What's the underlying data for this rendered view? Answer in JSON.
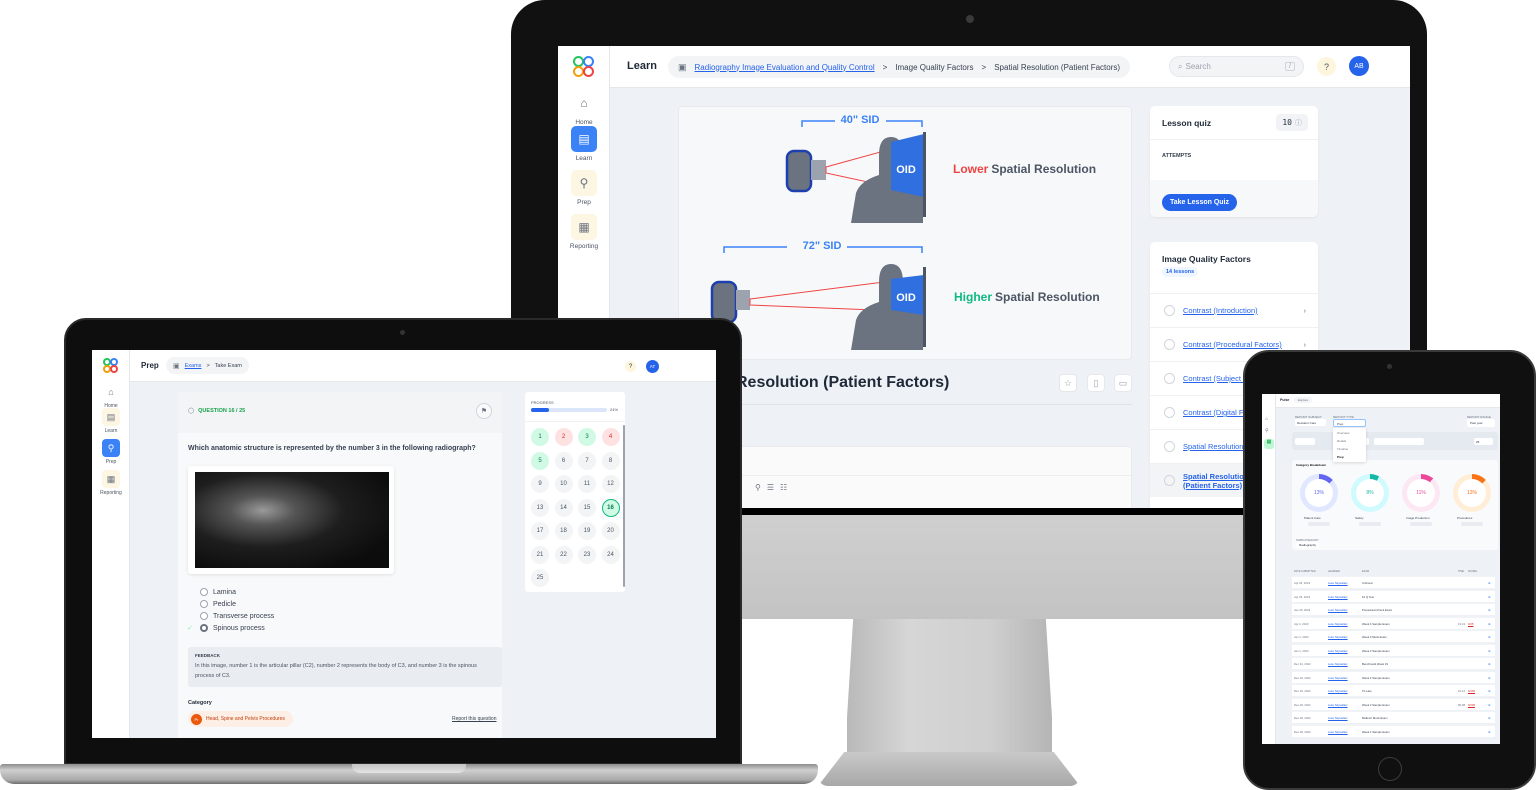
{
  "monitor": {
    "header": {
      "section_title": "Learn",
      "breadcrumb": [
        {
          "label": "Radiography Image Evaluation and Quality Control",
          "link": true
        },
        {
          "label": "Image Quality Factors",
          "link": false
        },
        {
          "label": "Spatial Resolution (Patient Factors)",
          "link": false
        }
      ],
      "breadcrumb_separator": ">",
      "search_placeholder": "Search",
      "search_shortcut": "/",
      "help_icon": "?",
      "avatar_initials": "AB"
    },
    "sidebar": {
      "items": [
        {
          "label": "Home",
          "icon": "home-icon",
          "active": false
        },
        {
          "label": "Learn",
          "icon": "book-icon",
          "active": true
        },
        {
          "label": "Prep",
          "icon": "compass-icon",
          "active": false
        },
        {
          "label": "Reporting",
          "icon": "chart-icon",
          "active": false
        }
      ]
    },
    "diagram": {
      "top": {
        "sid_label": "40\" SID",
        "oid_label": "OID",
        "result_prefix": "Lower",
        "result_suffix": "Spatial Resolution",
        "prefix_color": "#ef4444"
      },
      "bottom": {
        "sid_label": "72\" SID",
        "oid_label": "OID",
        "result_prefix": "Higher",
        "result_suffix": "Spatial Resolution",
        "prefix_color": "#10b981"
      }
    },
    "lesson_title_visible": "Resolution (Patient Factors)",
    "lesson_quiz": {
      "title": "Lesson quiz",
      "question_count": "10",
      "attempts_label": "ATTEMPTS",
      "button_label": "Take Lesson Quiz"
    },
    "lesson_list": {
      "title": "Image Quality Factors",
      "badge": "14 lessons",
      "items": [
        {
          "label": "Contrast (Introduction)",
          "active": false
        },
        {
          "label": "Contrast (Procedural Factors)",
          "active": false
        },
        {
          "label": "Contrast (Subject Factors)",
          "active": false
        },
        {
          "label": "Contrast (Digital Factors)",
          "active": false
        },
        {
          "label": "Spatial Resolution (Procedural Factors)",
          "active": false
        },
        {
          "label": "Spatial Resolution (Patient Factors)",
          "active": true
        }
      ]
    }
  },
  "laptop": {
    "header": {
      "section_title": "Prep",
      "breadcrumb": [
        {
          "label": "Exams",
          "link": true
        },
        {
          "label": "Take Exam",
          "link": false
        }
      ],
      "breadcrumb_separator": ">",
      "avatar_initials": "AT"
    },
    "sidebar": {
      "items": [
        {
          "label": "Home",
          "active": false
        },
        {
          "label": "Learn",
          "active": false
        },
        {
          "label": "Prep",
          "active": true
        },
        {
          "label": "Reporting",
          "active": false
        }
      ]
    },
    "question": {
      "counter": "QUESTION 16 / 25",
      "text": "Which anatomic structure is represented by the number 3 in the following radiograph?",
      "options": [
        "Lamina",
        "Pedicle",
        "Transverse process",
        "Spinous process"
      ],
      "selected_option": "Spinous process",
      "feedback_label": "FEEDBACK",
      "feedback_text": "In this image, number 1 is the articular pillar (C2), number 2 represents the body of C3, and number 3 is the spinous process of C3.",
      "category_label": "Category",
      "category_badge_initials": "Pr",
      "category_name": "Head, Spine and Pelvis Procedures",
      "report_link": "Report this question"
    },
    "progress": {
      "label": "PROGRESS",
      "percent_text": "24%",
      "fraction": 0.24,
      "questions": [
        {
          "n": "1",
          "state": "correct"
        },
        {
          "n": "2",
          "state": "wrong"
        },
        {
          "n": "3",
          "state": "correct"
        },
        {
          "n": "4",
          "state": "wrong"
        },
        {
          "n": "5",
          "state": "correct"
        },
        {
          "n": "6",
          "state": "none"
        },
        {
          "n": "7",
          "state": "none"
        },
        {
          "n": "8",
          "state": "none"
        },
        {
          "n": "9",
          "state": "none"
        },
        {
          "n": "10",
          "state": "none"
        },
        {
          "n": "11",
          "state": "none"
        },
        {
          "n": "12",
          "state": "none"
        },
        {
          "n": "13",
          "state": "none"
        },
        {
          "n": "14",
          "state": "none"
        },
        {
          "n": "15",
          "state": "none"
        },
        {
          "n": "16",
          "state": "current"
        },
        {
          "n": "17",
          "state": "none"
        },
        {
          "n": "18",
          "state": "none"
        },
        {
          "n": "19",
          "state": "none"
        },
        {
          "n": "20",
          "state": "none"
        },
        {
          "n": "21",
          "state": "none"
        },
        {
          "n": "22",
          "state": "none"
        },
        {
          "n": "23",
          "state": "none"
        },
        {
          "n": "24",
          "state": "none"
        },
        {
          "n": "25",
          "state": "none"
        }
      ]
    }
  },
  "tablet": {
    "header": {
      "section_title": "Pulse",
      "breadcrumb": "Explore"
    },
    "filters": {
      "report_subject_label": "REPORT SUBJECT",
      "report_subject_value": "Resident Care",
      "report_type_label": "REPORT TYPE",
      "report_type_value": "Prep",
      "report_type_options": [
        "Overview",
        "Details",
        "Timeline",
        "Prep"
      ],
      "report_range_label": "REPORT RANGE",
      "report_range_value": "Past year",
      "page_size_value": "25"
    },
    "category_breakdown": {
      "title": "Category Breakdown",
      "donuts": [
        {
          "label": "Patient Care",
          "value_text": "13%",
          "fraction": 0.13,
          "color": "#6366f1",
          "track": "#e0e7ff"
        },
        {
          "label": "Safety",
          "value_text": "8%",
          "fraction": 0.08,
          "color": "#14b8a6",
          "track": "#cffafe"
        },
        {
          "label": "Image Production",
          "value_text": "11%",
          "fraction": 0.11,
          "color": "#ec4899",
          "track": "#fce7f3"
        },
        {
          "label": "Procedures",
          "value_text": "13%",
          "fraction": 0.13,
          "color": "#f97316",
          "track": "#ffedd5"
        }
      ],
      "subcategory_label": "SUBCATEGORY",
      "subcategory_value": "Radiography"
    },
    "table": {
      "columns": [
        "DATE SUBMITTED",
        "LEARNER",
        "EXAM",
        "TIME",
        "SCORE",
        ""
      ],
      "rows": [
        {
          "date": "Apr 18, 2023",
          "learner": "Luke Skywalker",
          "exam": "Untimed",
          "time": "",
          "score": ""
        },
        {
          "date": "Apr 18, 2023",
          "learner": "Luke Skywalker",
          "exam": "10 Q Test",
          "time": "",
          "score": ""
        },
        {
          "date": "Jan 18, 2023",
          "learner": "Luke Skywalker",
          "exam": "Procedural Check Exam",
          "time": "",
          "score": ""
        },
        {
          "date": "Apr 2, 2023",
          "learner": "Luke Skywalker",
          "exam": "Week 4 Sample Exam",
          "time": "01:24",
          "score": "0/25"
        },
        {
          "date": "Jan 1, 2023",
          "learner": "Luke Skywalker",
          "exam": "Week 3 Mock Exam",
          "time": "",
          "score": ""
        },
        {
          "date": "Jan 1, 2023",
          "learner": "Luke Skywalker",
          "exam": "Week 3 Sample Exam",
          "time": "",
          "score": ""
        },
        {
          "date": "Dec 31, 2022",
          "learner": "Luke Skywalker",
          "exam": "Benchmark Week 19",
          "time": "",
          "score": ""
        },
        {
          "date": "Dec 29, 2022",
          "learner": "Luke Skywalker",
          "exam": "Week 2 Sample Exam",
          "time": "",
          "score": ""
        },
        {
          "date": "Dec 29, 2022",
          "learner": "Luke Skywalker",
          "exam": "Tri-Late",
          "time": "01:12",
          "score": "0/200"
        },
        {
          "date": "Dec 29, 2022",
          "learner": "Luke Skywalker",
          "exam": "Week 2 Sample Exam",
          "time": "00:08",
          "score": "0/200"
        },
        {
          "date": "Dec 28, 2022",
          "learner": "Luke Skywalker",
          "exam": "Midterm Mock Exam",
          "time": "",
          "score": ""
        },
        {
          "date": "Dec 28, 2022",
          "learner": "Luke Skywalker",
          "exam": "Week 1 Sample Exam",
          "time": "",
          "score": ""
        }
      ]
    }
  }
}
